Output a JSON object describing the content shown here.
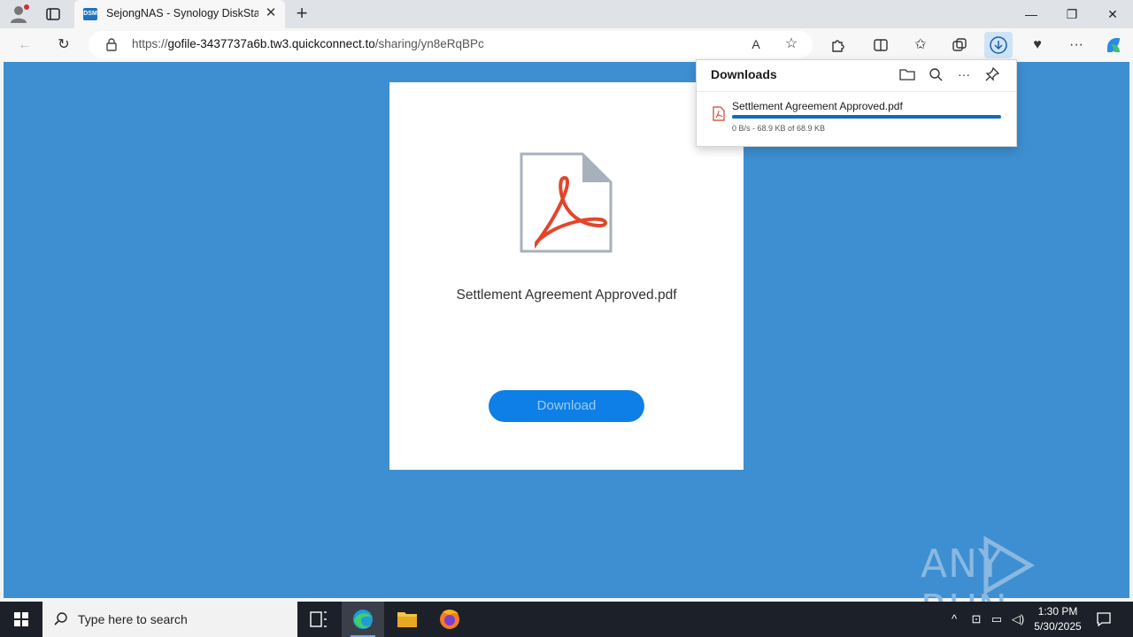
{
  "browser": {
    "tab_title": "SejongNAS - Synology DiskStation",
    "tab_favicon_text": "DSM",
    "url_prefix": "https://",
    "url_host": "gofile-3437737a6b.tw3.quickconnect.to",
    "url_path": "/sharing/yn8eRqBPc"
  },
  "page": {
    "filename": "Settlement Agreement Approved.pdf",
    "download_button": "Download",
    "bg_color": "#3d8fd1",
    "button_color": "#0d7fe6"
  },
  "downloads_panel": {
    "title": "Downloads",
    "item_name": "Settlement Agreement Approved.pdf",
    "item_status": "0 B/s - 68.9 KB of 68.9 KB",
    "progress_fraction": 1.0
  },
  "watermark": {
    "text": "ANY RUN"
  },
  "taskbar": {
    "search_placeholder": "Type here to search",
    "time": "1:30 PM",
    "date": "5/30/2025"
  },
  "icons": [
    "profile-icon",
    "tab-actions-icon",
    "close-icon",
    "new-tab-icon",
    "minimize-icon",
    "restore-icon",
    "back-icon",
    "refresh-icon",
    "lock-icon",
    "read-aloud-icon",
    "favorite-star-icon",
    "extensions-icon",
    "split-screen-icon",
    "favorites-icon",
    "collections-icon",
    "download-icon",
    "performance-icon",
    "more-icon",
    "copilot-icon",
    "folder-icon",
    "search-icon",
    "pin-icon",
    "pdf-file-icon",
    "windows-icon",
    "task-view-icon",
    "edge-icon",
    "file-explorer-icon",
    "firefox-icon",
    "chevron-up-icon",
    "network-icon",
    "volume-icon",
    "notification-icon"
  ]
}
